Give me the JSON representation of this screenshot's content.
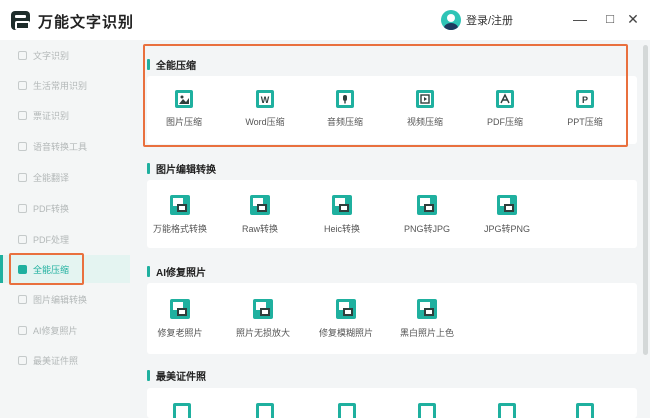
{
  "app": {
    "title": "万能文字识别"
  },
  "header": {
    "login_label": "登录/注册",
    "minimize": "—",
    "maximize": "□",
    "close": "✕"
  },
  "sidebar": {
    "items": [
      {
        "label": "文字识别"
      },
      {
        "label": "生活常用识别"
      },
      {
        "label": "票证识别"
      },
      {
        "label": "语音转换工具"
      },
      {
        "label": "全能翻译"
      },
      {
        "label": "PDF转换"
      },
      {
        "label": "PDF处理"
      },
      {
        "label": "全能压缩",
        "active": true
      },
      {
        "label": "图片编辑转换"
      },
      {
        "label": "AI修复照片"
      },
      {
        "label": "最美证件照"
      }
    ]
  },
  "sections": [
    {
      "title": "全能压缩",
      "tools": [
        {
          "label": "图片压缩",
          "icon": "image-compress-icon"
        },
        {
          "label": "Word压缩",
          "icon": "word-compress-icon"
        },
        {
          "label": "音频压缩",
          "icon": "audio-compress-icon"
        },
        {
          "label": "视频压缩",
          "icon": "video-compress-icon"
        },
        {
          "label": "PDF压缩",
          "icon": "pdf-compress-icon"
        },
        {
          "label": "PPT压缩",
          "icon": "ppt-compress-icon"
        }
      ]
    },
    {
      "title": "图片编辑转换",
      "tools": [
        {
          "label": "万能格式转换",
          "icon": "format-convert-icon"
        },
        {
          "label": "Raw转换",
          "icon": "raw-convert-icon"
        },
        {
          "label": "Heic转换",
          "icon": "heic-convert-icon"
        },
        {
          "label": "PNG转JPG",
          "icon": "png-to-jpg-icon"
        },
        {
          "label": "JPG转PNG",
          "icon": "jpg-to-png-icon"
        }
      ]
    },
    {
      "title": "AI修复照片",
      "tools": [
        {
          "label": "修复老照片",
          "icon": "restore-old-photo-icon"
        },
        {
          "label": "照片无损放大",
          "icon": "lossless-upscale-icon"
        },
        {
          "label": "修复模糊照片",
          "icon": "deblur-photo-icon"
        },
        {
          "label": "黑白照片上色",
          "icon": "colorize-photo-icon"
        }
      ]
    },
    {
      "title": "最美证件照",
      "tools": []
    }
  ],
  "colors": {
    "accent": "#1fb09f",
    "highlight": "#e9703e",
    "icon_green": "#1fb09f",
    "icon_dark": "#2f3e3c"
  }
}
